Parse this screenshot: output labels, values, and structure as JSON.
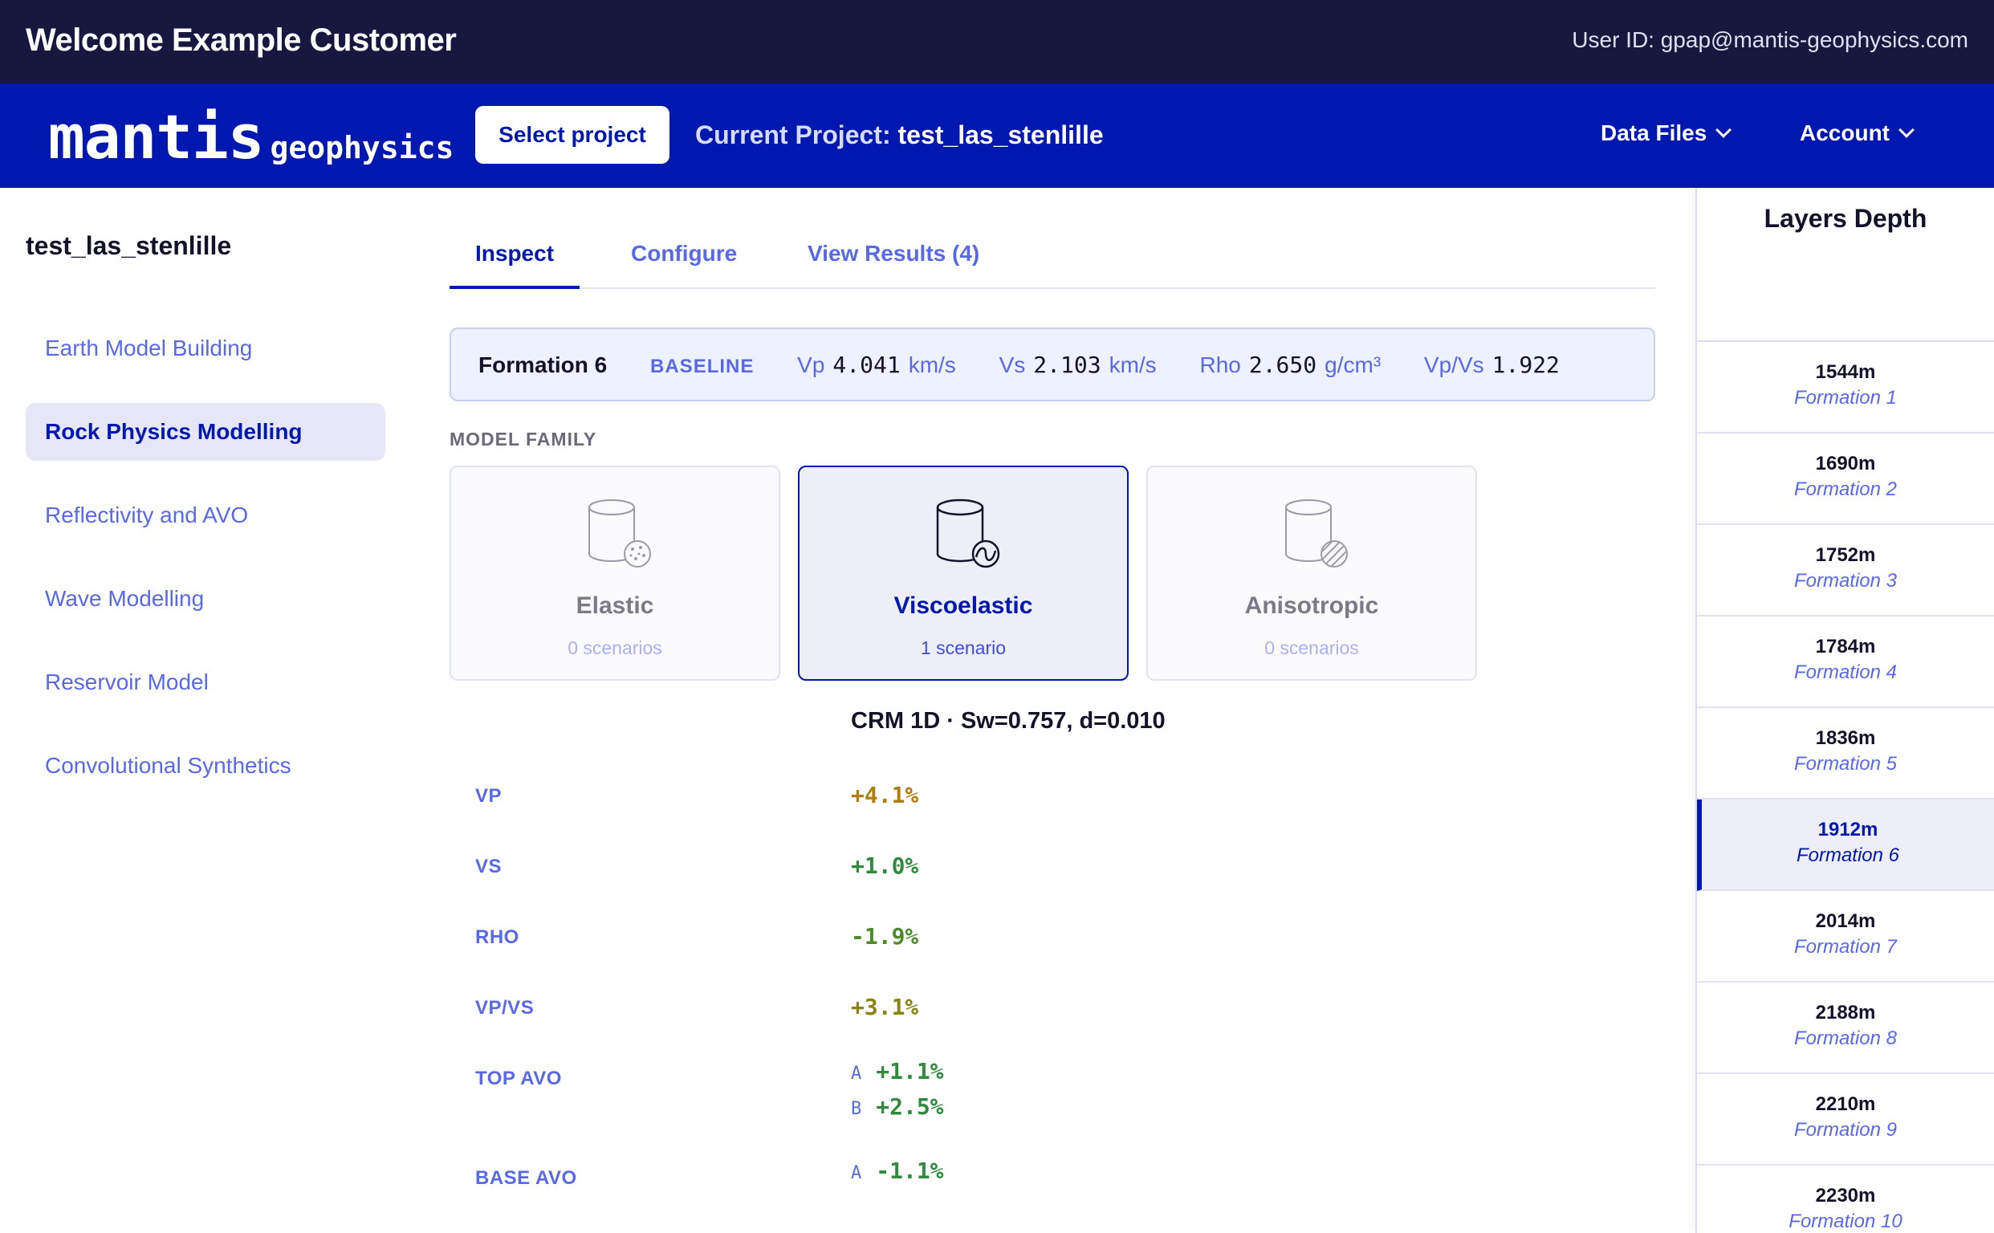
{
  "topbar": {
    "welcome": "Welcome Example Customer",
    "user_id": "User ID: gpap@mantis-geophysics.com"
  },
  "navbar": {
    "logo_main": "mantis",
    "logo_sub": "geophysics",
    "select_project": "Select project",
    "current_project_label": "Current Project:",
    "current_project_value": "test_las_stenlille",
    "data_files": "Data Files",
    "account": "Account"
  },
  "sidebar": {
    "project_name": "test_las_stenlille",
    "items": [
      {
        "label": "Earth Model Building",
        "active": false
      },
      {
        "label": "Rock Physics Modelling",
        "active": true
      },
      {
        "label": "Reflectivity and AVO",
        "active": false
      },
      {
        "label": "Wave Modelling",
        "active": false
      },
      {
        "label": "Reservoir Model",
        "active": false
      },
      {
        "label": "Convolutional Synthetics",
        "active": false
      }
    ]
  },
  "tabs": [
    {
      "label": "Inspect",
      "active": true
    },
    {
      "label": "Configure",
      "active": false
    },
    {
      "label": "View Results (4)",
      "active": false
    }
  ],
  "summary": {
    "formation": "Formation 6",
    "baseline": "BASELINE",
    "vp_label": "Vp",
    "vp_value": "4.041",
    "vp_unit": "km/s",
    "vs_label": "Vs",
    "vs_value": "2.103",
    "vs_unit": "km/s",
    "rho_label": "Rho",
    "rho_value": "2.650",
    "rho_unit": "g/cm³",
    "vpvs_label": "Vp/Vs",
    "vpvs_value": "1.922"
  },
  "model_family": {
    "label": "MODEL FAMILY",
    "cards": [
      {
        "name": "Elastic",
        "sub": "0 scenarios",
        "selected": false,
        "icon": "elastic-cylinder-icon"
      },
      {
        "name": "Viscoelastic",
        "sub": "1 scenario",
        "selected": true,
        "icon": "viscoelastic-cylinder-icon"
      },
      {
        "name": "Anisotropic",
        "sub": "0 scenarios",
        "selected": false,
        "icon": "anisotropic-cylinder-icon"
      }
    ]
  },
  "scenario": {
    "title": "CRM 1D · Sw=0.757, d=0.010",
    "rows": [
      {
        "label": "VP",
        "value": "+4.1%",
        "color": "#b07d14"
      },
      {
        "label": "VS",
        "value": "+1.0%",
        "color": "#2f8a3e"
      },
      {
        "label": "RHO",
        "value": "-1.9%",
        "color": "#4f8a2a"
      },
      {
        "label": "VP/VS",
        "value": "+3.1%",
        "color": "#8a8214"
      },
      {
        "label": "TOP AVO",
        "a_tag": "A",
        "a_value": "+1.1%",
        "b_tag": "B",
        "b_value": "+2.5%",
        "color": "#2f8a3e"
      },
      {
        "label": "BASE AVO",
        "a_tag": "A",
        "a_value": "-1.1%",
        "color": "#2f8a3e"
      }
    ]
  },
  "layers": {
    "title": "Layers Depth",
    "items": [
      {
        "depth": "1544m",
        "name": "Formation 1",
        "active": false
      },
      {
        "depth": "1690m",
        "name": "Formation 2",
        "active": false
      },
      {
        "depth": "1752m",
        "name": "Formation 3",
        "active": false
      },
      {
        "depth": "1784m",
        "name": "Formation 4",
        "active": false
      },
      {
        "depth": "1836m",
        "name": "Formation 5",
        "active": false
      },
      {
        "depth": "1912m",
        "name": "Formation 6",
        "active": true
      },
      {
        "depth": "2014m",
        "name": "Formation 7",
        "active": false
      },
      {
        "depth": "2188m",
        "name": "Formation 8",
        "active": false
      },
      {
        "depth": "2210m",
        "name": "Formation 9",
        "active": false
      },
      {
        "depth": "2230m",
        "name": "Formation 10",
        "active": false
      }
    ]
  },
  "colors": {
    "topbar_bg": "#17173f",
    "navbar_bg": "#0018ad",
    "accent": "#5869e6",
    "active_bg": "#eeeef9"
  }
}
